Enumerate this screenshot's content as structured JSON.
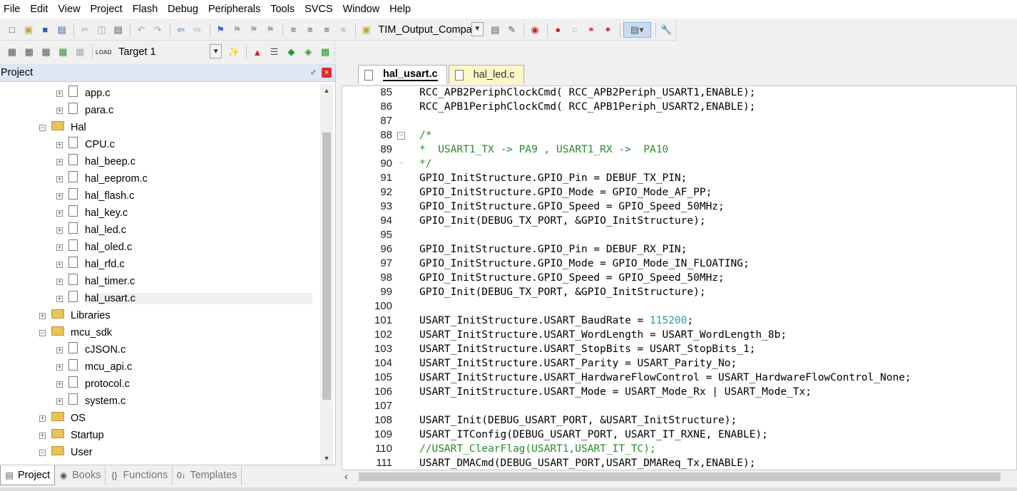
{
  "menu": [
    "File",
    "Edit",
    "View",
    "Project",
    "Flash",
    "Debug",
    "Peripherals",
    "Tools",
    "SVCS",
    "Window",
    "Help"
  ],
  "toolbar": {
    "target_combo": "TIM_Output_Compa",
    "build_target": "Target 1"
  },
  "project_panel": {
    "title": "Project",
    "pin_glyph": "♂",
    "close_glyph": "×"
  },
  "tree": [
    {
      "label": "app.c",
      "kind": "file",
      "level": 2
    },
    {
      "label": "para.c",
      "kind": "file",
      "level": 2
    },
    {
      "label": "Hal",
      "kind": "folder",
      "level": 1,
      "expanded": true
    },
    {
      "label": "CPU.c",
      "kind": "file",
      "level": 2
    },
    {
      "label": "hal_beep.c",
      "kind": "file",
      "level": 2
    },
    {
      "label": "hal_eeprom.c",
      "kind": "file",
      "level": 2
    },
    {
      "label": "hal_flash.c",
      "kind": "file",
      "level": 2
    },
    {
      "label": "hal_key.c",
      "kind": "file",
      "level": 2
    },
    {
      "label": "hal_led.c",
      "kind": "file",
      "level": 2
    },
    {
      "label": "hal_oled.c",
      "kind": "file",
      "level": 2
    },
    {
      "label": "hal_rfd.c",
      "kind": "file",
      "level": 2
    },
    {
      "label": "hal_timer.c",
      "kind": "file",
      "level": 2
    },
    {
      "label": "hal_usart.c",
      "kind": "file",
      "level": 2,
      "selected": true
    },
    {
      "label": "Libraries",
      "kind": "folder",
      "level": 1,
      "expanded": false
    },
    {
      "label": "mcu_sdk",
      "kind": "folder",
      "level": 1,
      "expanded": true
    },
    {
      "label": "cJSON.c",
      "kind": "file",
      "level": 2
    },
    {
      "label": "mcu_api.c",
      "kind": "file",
      "level": 2
    },
    {
      "label": "protocol.c",
      "kind": "file",
      "level": 2
    },
    {
      "label": "system.c",
      "kind": "file",
      "level": 2
    },
    {
      "label": "OS",
      "kind": "folder",
      "level": 1,
      "expanded": false
    },
    {
      "label": "Startup",
      "kind": "folder",
      "level": 1,
      "expanded": false
    },
    {
      "label": "User",
      "kind": "folder",
      "level": 1,
      "expanded": true
    }
  ],
  "panel_tabs": [
    {
      "label": "Project",
      "icon": "project-icon",
      "active": true
    },
    {
      "label": "Books",
      "icon": "books-icon",
      "active": false
    },
    {
      "label": "Functions",
      "icon": "functions-icon",
      "active": false
    },
    {
      "label": "Templates",
      "icon": "templates-icon",
      "active": false
    }
  ],
  "editor_tabs": [
    {
      "label": "hal_usart.c",
      "active": true
    },
    {
      "label": "hal_led.c",
      "active": false
    }
  ],
  "code_lines": [
    {
      "n": "85",
      "t": "RCC_APB2PeriphClockCmd( RCC_APB2Periph_USART1,ENABLE);"
    },
    {
      "n": "86",
      "t": "RCC_APB1PeriphClockCmd( RCC_APB1Periph_USART2,ENABLE);"
    },
    {
      "n": "87",
      "t": ""
    },
    {
      "n": "88",
      "t": "/*",
      "cls": "comment",
      "fold": "box"
    },
    {
      "n": "89",
      "t": "*  USART1_TX -> PA9 , USART1_RX ->  PA10",
      "cls": "comment"
    },
    {
      "n": "90",
      "t": "*/",
      "cls": "comment",
      "fold": "end"
    },
    {
      "n": "91",
      "t": "GPIO_InitStructure.GPIO_Pin = DEBUF_TX_PIN;"
    },
    {
      "n": "92",
      "t": "GPIO_InitStructure.GPIO_Mode = GPIO_Mode_AF_PP;"
    },
    {
      "n": "93",
      "t": "GPIO_InitStructure.GPIO_Speed = GPIO_Speed_50MHz;"
    },
    {
      "n": "94",
      "t": "GPIO_Init(DEBUG_TX_PORT, &GPIO_InitStructure);"
    },
    {
      "n": "95",
      "t": ""
    },
    {
      "n": "96",
      "t": "GPIO_InitStructure.GPIO_Pin = DEBUF_RX_PIN;"
    },
    {
      "n": "97",
      "t": "GPIO_InitStructure.GPIO_Mode = GPIO_Mode_IN_FLOATING;"
    },
    {
      "n": "98",
      "t": "GPIO_InitStructure.GPIO_Speed = GPIO_Speed_50MHz;"
    },
    {
      "n": "99",
      "t": "GPIO_Init(DEBUG_TX_PORT, &GPIO_InitStructure);"
    },
    {
      "n": "100",
      "t": ""
    },
    {
      "n": "101",
      "t": "USART_InitStructure.USART_BaudRate = ",
      "num": "115200",
      "tail": ";"
    },
    {
      "n": "102",
      "t": "USART_InitStructure.USART_WordLength = USART_WordLength_8b;"
    },
    {
      "n": "103",
      "t": "USART_InitStructure.USART_StopBits = USART_StopBits_1;"
    },
    {
      "n": "104",
      "t": "USART_InitStructure.USART_Parity = USART_Parity_No;"
    },
    {
      "n": "105",
      "t": "USART_InitStructure.USART_HardwareFlowControl = USART_HardwareFlowControl_None;"
    },
    {
      "n": "106",
      "t": "USART_InitStructure.USART_Mode = USART_Mode_Rx | USART_Mode_Tx;"
    },
    {
      "n": "107",
      "t": ""
    },
    {
      "n": "108",
      "t": "USART_Init(DEBUG_USART_PORT, &USART_InitStructure);"
    },
    {
      "n": "109",
      "t": "USART_ITConfig(DEBUG_USART_PORT, USART_IT_RXNE, ENABLE);"
    },
    {
      "n": "110",
      "t": "//USART_ClearFlag(USART1,USART_IT_TC);",
      "cls": "comment"
    },
    {
      "n": "111",
      "t": "USART_DMACmd(DEBUG_USART_PORT,USART_DMAReq_Tx,ENABLE);"
    }
  ],
  "colors": {
    "comment": "#2a8a2a",
    "number": "#2a9a9a",
    "panel_header": "#dce6f4",
    "inactive_tab": "#fff6c8"
  }
}
